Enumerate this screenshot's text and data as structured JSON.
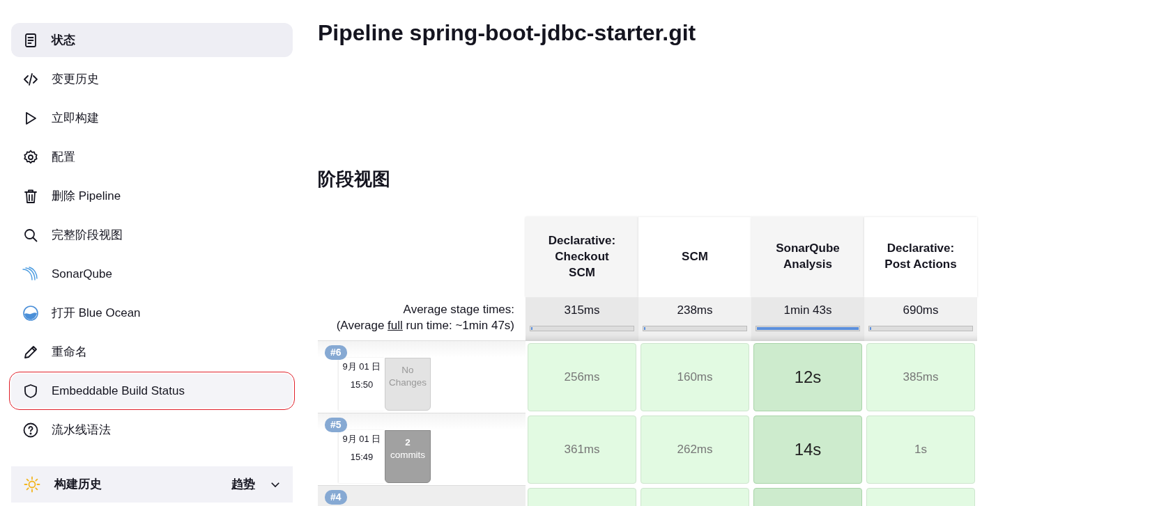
{
  "sidebar": {
    "items": [
      {
        "label": "状态",
        "selected": true,
        "outlined": false
      },
      {
        "label": "变更历史",
        "selected": false,
        "outlined": false
      },
      {
        "label": "立即构建",
        "selected": false,
        "outlined": false
      },
      {
        "label": "配置",
        "selected": false,
        "outlined": false
      },
      {
        "label": "删除 Pipeline",
        "selected": false,
        "outlined": false
      },
      {
        "label": "完整阶段视图",
        "selected": false,
        "outlined": false
      },
      {
        "label": "SonarQube",
        "selected": false,
        "outlined": false
      },
      {
        "label": "打开 Blue Ocean",
        "selected": false,
        "outlined": false
      },
      {
        "label": "重命名",
        "selected": false,
        "outlined": false
      },
      {
        "label": "Embeddable Build Status",
        "selected": false,
        "outlined": true
      },
      {
        "label": "流水线语法",
        "selected": false,
        "outlined": false
      }
    ],
    "build_history": {
      "title": "构建历史",
      "trend_link": "趋势",
      "expanded": false
    }
  },
  "page": {
    "title": "Pipeline spring-boot-jdbc-starter.git",
    "stage_view_heading": "阶段视图"
  },
  "stage_view": {
    "stages": [
      "Declarative: Checkout SCM",
      "SCM",
      "SonarQube Analysis",
      "Declarative: Post Actions"
    ],
    "average_label": "Average stage times:",
    "average_note_before": "(Average ",
    "average_note_link": "full",
    "average_note_after": " run time: ~1min 47s)",
    "averages": [
      {
        "time": "315ms",
        "level": 0.01
      },
      {
        "time": "238ms",
        "level": 0.01
      },
      {
        "time": "1min 43s",
        "level": 1
      },
      {
        "time": "690ms",
        "level": 0.01
      }
    ],
    "builds": [
      {
        "number": "#6",
        "date": "9月 01 日",
        "time": "15:50",
        "changes": {
          "kind": "none",
          "text": "No Changes"
        },
        "cells": [
          {
            "time": "256ms",
            "longest": false
          },
          {
            "time": "160ms",
            "longest": false
          },
          {
            "time": "12s",
            "longest": true
          },
          {
            "time": "385ms",
            "longest": false
          }
        ]
      },
      {
        "number": "#5",
        "date": "9月 01 日",
        "time": "15:49",
        "changes": {
          "kind": "commits",
          "count": "2",
          "text": "commits"
        },
        "cells": [
          {
            "time": "361ms",
            "longest": false
          },
          {
            "time": "262ms",
            "longest": false
          },
          {
            "time": "14s",
            "longest": true
          },
          {
            "time": "1s",
            "longest": false
          }
        ]
      },
      {
        "number": "#4",
        "cells": [
          {
            "longest": false
          },
          {
            "longest": false
          },
          {
            "longest": true
          },
          {
            "longest": false
          }
        ]
      }
    ]
  }
}
